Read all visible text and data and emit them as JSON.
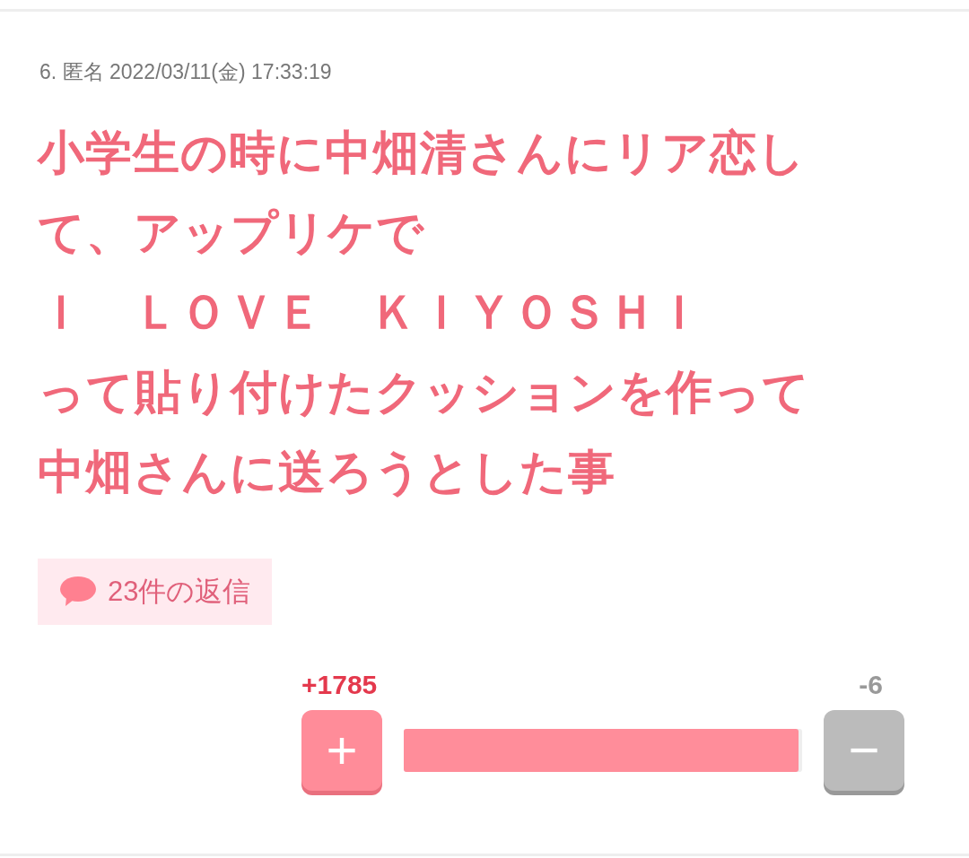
{
  "comment": {
    "meta": "6. 匿名 2022/03/11(金) 17:33:19",
    "body_lines": [
      "小学生の時に中畑清さんにリア恋し",
      "て、アップリケで",
      "Ｉ　ＬＯＶＥ　ＫＩＹＯＳＨＩ",
      "って貼り付けたクッションを作って",
      "中畑さんに送ろうとした事"
    ],
    "replies": "23件の返信",
    "votes": {
      "plus_count": "+1785",
      "minus_count": "-6",
      "plus_label": "+",
      "minus_label": "−",
      "level": 0.992
    }
  }
}
